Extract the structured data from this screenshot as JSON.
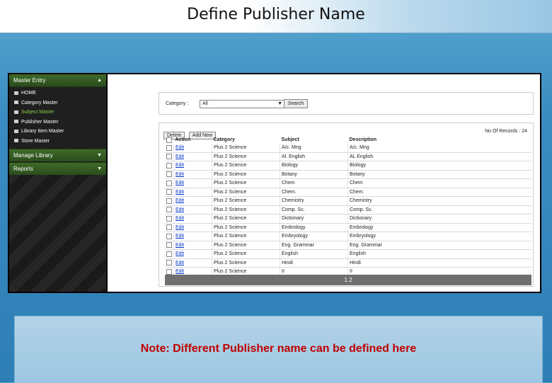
{
  "slide": {
    "title": "Define Publisher Name",
    "note": "Note: Different Publisher name can be defined here"
  },
  "sidebar": {
    "master_entry": {
      "label": "Master Entry",
      "items": [
        {
          "label": "HOME",
          "active": false
        },
        {
          "label": "Category Master",
          "active": false
        },
        {
          "label": "Subject Master",
          "active": true
        },
        {
          "label": "Publisher Master",
          "active": false
        },
        {
          "label": "Library Item Master",
          "active": false
        },
        {
          "label": "Store Master",
          "active": false
        }
      ]
    },
    "manage_library": {
      "label": "Manage Library"
    },
    "reports": {
      "label": "Reports"
    }
  },
  "filter": {
    "label": "Category :",
    "selected": "All",
    "search_label": "Search"
  },
  "grid": {
    "delete_label": "Delete",
    "add_new_label": "Add New",
    "records_text": "No Of Records : 24",
    "headers": [
      "Action",
      "Category",
      "Subject",
      "Description"
    ],
    "rows": [
      {
        "action": "Edit",
        "category": "Plus 2 Science",
        "subject": "A/c. Mng",
        "description": "A/c. Mng"
      },
      {
        "action": "Edit",
        "category": "Plus 2 Science",
        "subject": "Al. English",
        "description": "AL English"
      },
      {
        "action": "Edit",
        "category": "Plus 2 Science",
        "subject": "Biology",
        "description": "Biology"
      },
      {
        "action": "Edit",
        "category": "Plus 2 Science",
        "subject": "Botany",
        "description": "Botany"
      },
      {
        "action": "Edit",
        "category": "Plus 2 Science",
        "subject": "Chem",
        "description": "Chem"
      },
      {
        "action": "Edit",
        "category": "Plus 2 Science",
        "subject": "Chem.",
        "description": "Chem."
      },
      {
        "action": "Edit",
        "category": "Plus 2 Science",
        "subject": "Chemistry",
        "description": "Chemistry"
      },
      {
        "action": "Edit",
        "category": "Plus 2 Science",
        "subject": "Comp. Sc.",
        "description": "Comp. Sc."
      },
      {
        "action": "Edit",
        "category": "Plus 2 Science",
        "subject": "Dictionary",
        "description": "Dictionary"
      },
      {
        "action": "Edit",
        "category": "Plus 2 Science",
        "subject": "Embrology",
        "description": "Embrology"
      },
      {
        "action": "Edit",
        "category": "Plus 2 Science",
        "subject": "Embryology",
        "description": "Embryology"
      },
      {
        "action": "Edit",
        "category": "Plus 2 Science",
        "subject": "Eng. Grammar",
        "description": "Eng. Grammar"
      },
      {
        "action": "Edit",
        "category": "Plus 2 Science",
        "subject": "English",
        "description": "English"
      },
      {
        "action": "Edit",
        "category": "Plus 2 Science",
        "subject": "Hindi",
        "description": "Hindi"
      },
      {
        "action": "Edit",
        "category": "Plus 2 Science",
        "subject": "II",
        "description": "II"
      }
    ],
    "pager_text": "1 2"
  }
}
